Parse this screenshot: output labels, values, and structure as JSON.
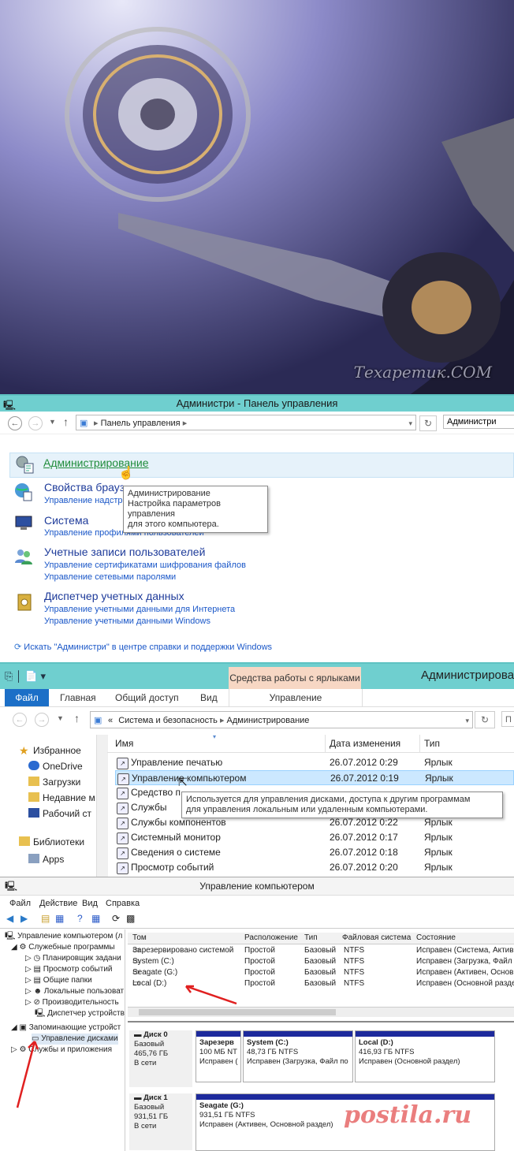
{
  "hero": {
    "watermark": "Техаретик.СОМ"
  },
  "control_panel": {
    "title": "Администри - Панель управления",
    "breadcrumb": "Панель управления",
    "search_value": "Администри",
    "items": [
      {
        "title": "Администрирование",
        "subs": []
      },
      {
        "title": "Свойства брауз",
        "subs": [
          "Управление надстро"
        ]
      },
      {
        "title": "Система",
        "subs": [
          "Управление профилями пользователей"
        ]
      },
      {
        "title": "Учетные записи пользователей",
        "subs": [
          "Управление сертификатами шифрования файлов",
          "Управление сетевыми паролями"
        ]
      },
      {
        "title": "Диспетчер учетных данных",
        "subs": [
          "Управление учетными данными для Интернета",
          "Управление учетными данными Windows"
        ]
      }
    ],
    "tooltip": {
      "line1": "Администрирование",
      "line2": "Настройка параметров управления",
      "line3": "для этого компьютера."
    },
    "help_link": "Искать \"Администри\" в центре справки и поддержки Windows"
  },
  "explorer": {
    "title": "Администрирова",
    "contextual_tab": "Средства работы с ярлыками",
    "tabs": [
      "Файл",
      "Главная",
      "Общий доступ",
      "Вид",
      "Управление"
    ],
    "breadcrumb": [
      "«",
      "Система и безопасность",
      "Администрирование"
    ],
    "nav": [
      "Избранное",
      "OneDrive",
      "Загрузки",
      "Недавние м",
      "Рабочий ст",
      "Библиотеки",
      "Apps"
    ],
    "columns": [
      "Имя",
      "Дата изменения",
      "Тип"
    ],
    "rows": [
      {
        "name": "Управление печатью",
        "date": "26.07.2012 0:29",
        "type": "Ярлык"
      },
      {
        "name": "Управление компьютером",
        "date": "26.07.2012 0:19",
        "type": "Ярлык"
      },
      {
        "name": "Средство п",
        "date": "",
        "type": ""
      },
      {
        "name": "Службы",
        "date": "",
        "type": ""
      },
      {
        "name": "Службы компонентов",
        "date": "26.07.2012 0:22",
        "type": "Ярлык"
      },
      {
        "name": "Системный монитор",
        "date": "26.07.2012 0:17",
        "type": "Ярлык"
      },
      {
        "name": "Сведения о системе",
        "date": "26.07.2012 0:18",
        "type": "Ярлык"
      },
      {
        "name": "Просмотр событий",
        "date": "26.07.2012 0:20",
        "type": "Ярлык"
      }
    ],
    "tooltip": {
      "line1": "Используется для управления дисками, доступа к другим программам",
      "line2": "для управления локальным или удаленным компьютерами."
    }
  },
  "disk_mgmt": {
    "title": "Управление компьютером",
    "menu": [
      "Файл",
      "Действие",
      "Вид",
      "Справка"
    ],
    "tree": [
      "Управление компьютером (л",
      "Служебные программы",
      "Планировщик задани",
      "Просмотр событий",
      "Общие папки",
      "Локальные пользоват",
      "Производительность",
      "Диспетчер устройств",
      "Запоминающие устройст",
      "Управление дисками",
      "Службы и приложения"
    ],
    "columns": [
      "Том",
      "Расположение",
      "Тип",
      "Файловая система",
      "Состояние"
    ],
    "volumes": [
      {
        "name": "Зарезервировано системой",
        "loc": "Простой",
        "type": "Базовый",
        "fs": "NTFS",
        "state": "Исправен (Система, Актив"
      },
      {
        "name": "System (C:)",
        "loc": "Простой",
        "type": "Базовый",
        "fs": "NTFS",
        "state": "Исправен (Загрузка, Файл"
      },
      {
        "name": "Seagate (G:)",
        "loc": "Простой",
        "type": "Базовый",
        "fs": "NTFS",
        "state": "Исправен (Активен, Основ"
      },
      {
        "name": "Local (D:)",
        "loc": "Простой",
        "type": "Базовый",
        "fs": "NTFS",
        "state": "Исправен (Основной разде"
      }
    ],
    "disk0": {
      "name": "Диск 0",
      "kind": "Базовый",
      "size": "465,76 ГБ",
      "status": "В сети",
      "parts": [
        {
          "name": "Зарезерв",
          "size": "100 МБ NT",
          "state": "Исправен ("
        },
        {
          "name": "System (C:)",
          "size": "48,73 ГБ NTFS",
          "state": "Исправен (Загрузка, Файл по"
        },
        {
          "name": "Local (D:)",
          "size": "416,93 ГБ NTFS",
          "state": "Исправен (Основной раздел)"
        }
      ]
    },
    "disk1": {
      "name": "Диск 1",
      "kind": "Базовый",
      "size": "931,51 ГБ",
      "status": "В сети",
      "parts": [
        {
          "name": "Seagate (G:)",
          "size": "931,51 ГБ NTFS",
          "state": "Исправен (Активен, Основной раздел)"
        }
      ]
    },
    "watermark": "postila.ru"
  },
  "colors": {
    "titlebar": "#6fcfcf",
    "file_tab": "#1c6fc7",
    "partition_bar": "#1d2a9c",
    "arrow": "#e02020"
  }
}
